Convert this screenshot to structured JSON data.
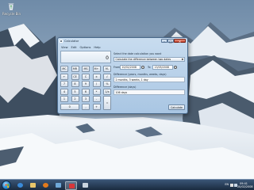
{
  "desktop": {
    "recycle_bin_label": "Recycle Bin"
  },
  "window": {
    "title": "Calculator",
    "minimize_glyph": "–",
    "maximize_glyph": "□",
    "close_glyph": "✕"
  },
  "menu": {
    "items": [
      "View",
      "Edit",
      "Options",
      "Help"
    ]
  },
  "calculator": {
    "display_value": "0",
    "keys": {
      "mc": "MC",
      "mr": "MR",
      "ms": "MS",
      "mplus": "M+",
      "mminus": "M-",
      "back": "←",
      "ce": "CE",
      "c": "C",
      "plusminus": "±",
      "sqrt": "√",
      "k7": "7",
      "k8": "8",
      "k9": "9",
      "div": "/",
      "pct": "%",
      "k4": "4",
      "k5": "5",
      "k6": "6",
      "mul": "*",
      "recip": "1/x",
      "k1": "1",
      "k2": "2",
      "k3": "3",
      "minus": "-",
      "eq": "=",
      "k0": "0",
      "dot": ",",
      "plus": "+"
    }
  },
  "date_calc": {
    "heading": "Select the date calculation you want",
    "mode_selected": "Calculate the difference between two dates",
    "from_label": "From",
    "from_value": "20/02/2008",
    "to_label": "To",
    "to_value": "13/05/2008",
    "diff_label_long": "Difference (years, months, weeks, days)",
    "diff_value_long": "2 months, 3 weeks, 1 day",
    "diff_label_days": "Difference (days)",
    "diff_value_days": "106 days",
    "calculate_label": "Calculate"
  },
  "taskbar": {
    "language": "EN",
    "time": "09:41",
    "date": "20/02/2008"
  },
  "colors": {
    "taskbar": "#1f3350",
    "window_frame": "#a9c6e3",
    "close_button": "#c2402a"
  }
}
